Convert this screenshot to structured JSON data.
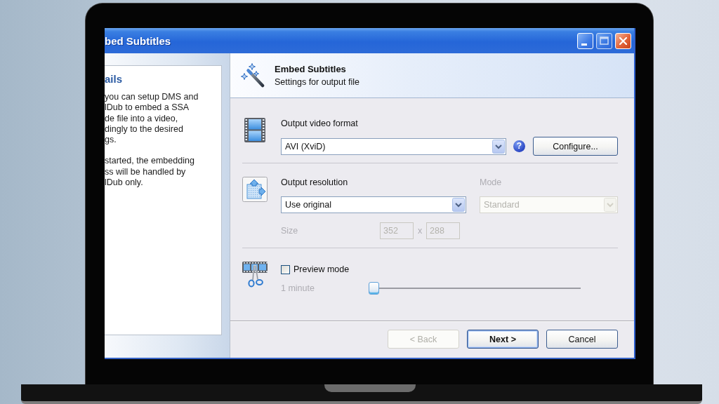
{
  "window": {
    "title": "bed Subtitles"
  },
  "details": {
    "heading": "ails",
    "paragraphs": [
      [
        "you can setup DMS and",
        "lDub to embed a SSA",
        "de file into a video,",
        "dingly to the desired",
        "gs."
      ],
      [
        "started, the embedding",
        "ss will be handled by",
        "lDub only."
      ]
    ]
  },
  "header": {
    "title": "Embed Subtitles",
    "subtitle": "Settings for output file"
  },
  "format": {
    "label": "Output video format",
    "dropdown": {
      "value": "AVI (XviD)",
      "disabled": false
    },
    "help": "?",
    "configure": "Configure..."
  },
  "resolution": {
    "label": "Output resolution",
    "dropdown": {
      "value": "Use original",
      "disabled": false
    },
    "mode": {
      "label": "Mode",
      "value": "Standard",
      "disabled": true
    },
    "size": {
      "label": "Size",
      "disabled": true,
      "values": [
        "352",
        "288"
      ],
      "separator": "x"
    }
  },
  "preview": {
    "checkbox": {
      "label": "Preview mode",
      "checked": false
    },
    "duration": {
      "label": "1 minute",
      "disabled": true
    },
    "slider": {
      "level": 0
    }
  },
  "buttons": [
    {
      "label": "< Back",
      "disabled": true,
      "default": false
    },
    {
      "label": "Next >",
      "disabled": false,
      "default": true
    },
    {
      "label": "Cancel",
      "disabled": false,
      "default": false
    }
  ]
}
